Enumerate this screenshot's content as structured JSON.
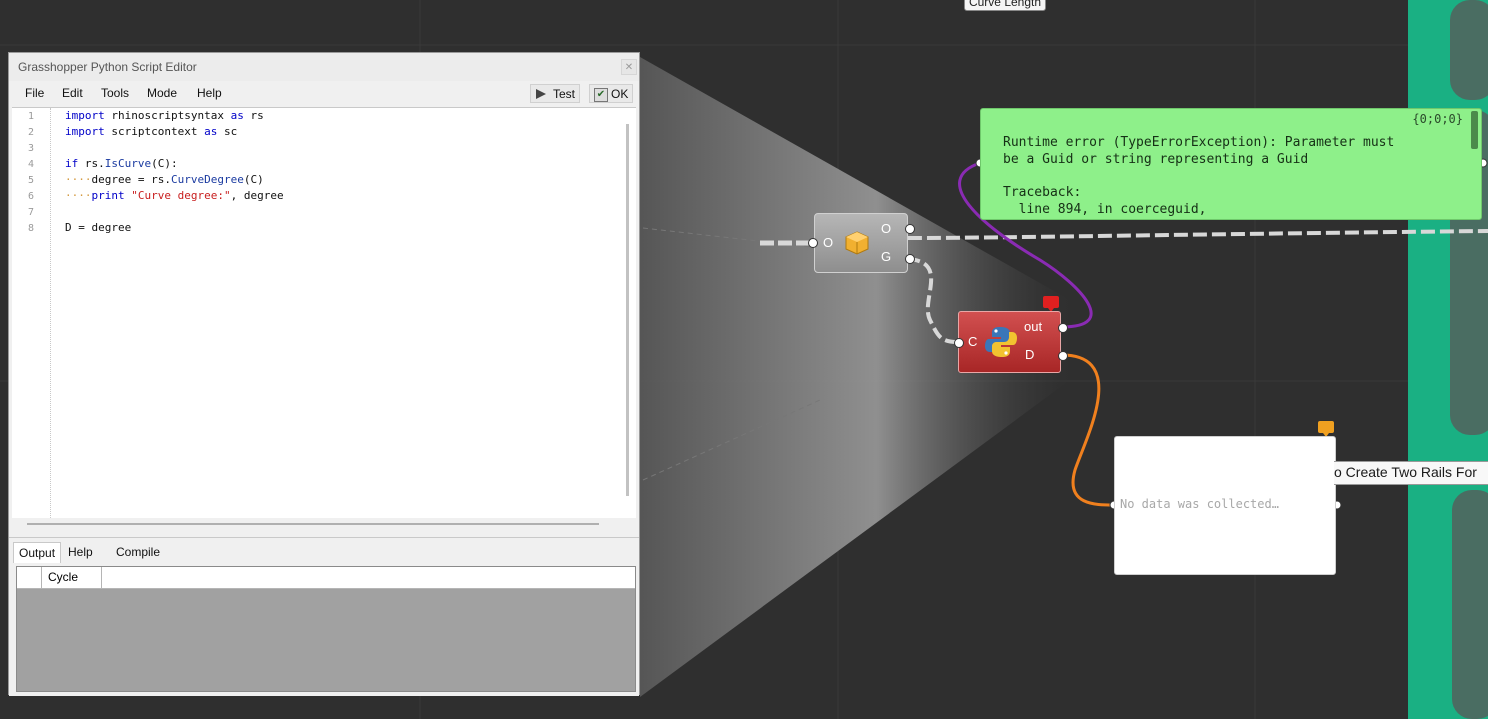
{
  "editor": {
    "title": "Grasshopper Python Script Editor",
    "close": "✕",
    "menu": [
      "File",
      "Edit",
      "Tools",
      "Mode",
      "Help"
    ],
    "test_label": "Test",
    "ok_label": "OK",
    "line_numbers": [
      "1",
      "2",
      "3",
      "4",
      "5",
      "6",
      "7",
      "8"
    ],
    "code": {
      "l1_kw": "import",
      "l1_rest": " rhinoscriptsyntax ",
      "l1_as": "as",
      "l1_end": " rs",
      "l2_kw": "import",
      "l2_rest": " scriptcontext ",
      "l2_as": "as",
      "l2_end": " sc",
      "l4_kw": "if",
      "l4_rest": " rs.",
      "l4_fn": "IsCurve",
      "l4_end": "(C):",
      "l5_dots": "····",
      "l5_a": "degree = rs.",
      "l5_fn": "CurveDegree",
      "l5_end": "(C)",
      "l6_dots": "····",
      "l6_kw": "print",
      "l6_sp": " ",
      "l6_str": "\"Curve degree:\"",
      "l6_end": ", degree",
      "l8": "D = degree"
    },
    "tabs": [
      "Output",
      "Help",
      "Compile"
    ],
    "grid_header": "Cycle"
  },
  "canvas": {
    "top_label": "Curve Length",
    "error": {
      "path": "{0;0;0}",
      "lines": [
        "Runtime error (TypeErrorException): Parameter must",
        "be a Guid or string representing a Guid",
        "",
        "Traceback:",
        "  line 894, in coerceguid,"
      ]
    },
    "decon": {
      "in": "O",
      "out1": "O",
      "out2": "G"
    },
    "python": {
      "in": "C",
      "out1": "out",
      "out2": "D"
    },
    "panel_text": "No data was collected…",
    "group_label": "o Create Two Rails For"
  },
  "colors": {
    "canvas_bg": "#2f2f2f",
    "group_green": "#1ab083",
    "error_green": "#8ef08a",
    "python_red": "#c03c3c",
    "wire_purple": "#8a2bb3",
    "wire_orange": "#f0801e"
  }
}
